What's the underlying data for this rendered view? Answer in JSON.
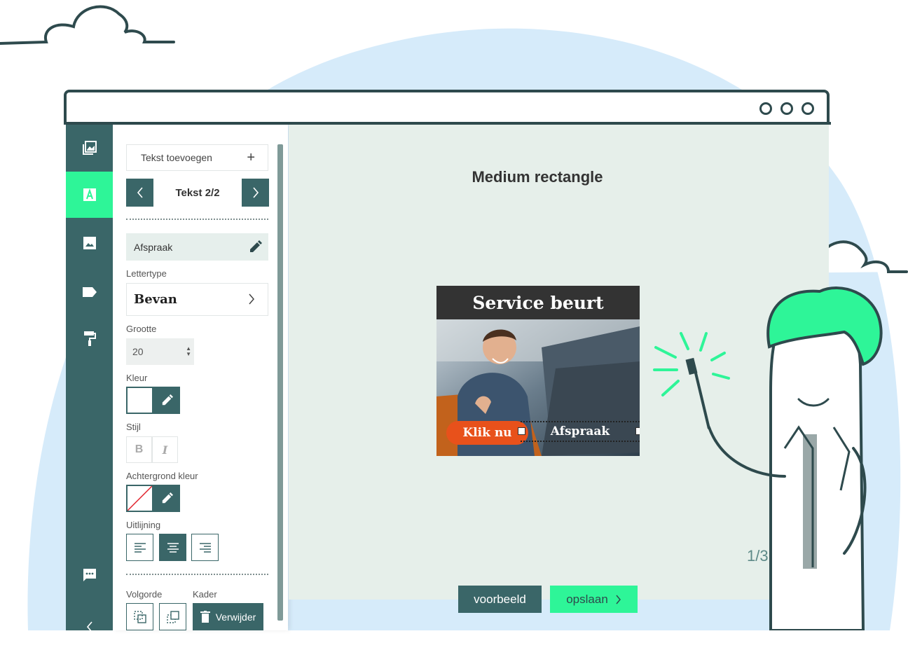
{
  "panel": {
    "add_text_label": "Tekst toevoegen",
    "nav_title": "Tekst 2/2",
    "layer_name": "Afspraak",
    "font_label": "Lettertype",
    "font_value": "Bevan",
    "size_label": "Grootte",
    "size_value": "20",
    "color_label": "Kleur",
    "style_label": "Stijl",
    "bold_label": "B",
    "italic_label": "I",
    "bg_color_label": "Achtergrond kleur",
    "align_label": "Uitlijning",
    "order_label": "Volgorde",
    "frame_label": "Kader",
    "delete_label": "Verwijder"
  },
  "canvas": {
    "title": "Medium rectangle",
    "page_counter": "1/3"
  },
  "ad": {
    "headline": "Service beurt",
    "cta": "Klik nu",
    "selected_text": "Afspraak"
  },
  "actions": {
    "preview_label": "voorbeeld",
    "save_label": "opslaan"
  },
  "colors": {
    "accent": "#2ef598",
    "primary": "#3a6668",
    "outline": "#2e4a4d",
    "sky": "#d6ebfa",
    "canvas_bg": "#e6efea",
    "cta": "#e8511b"
  },
  "icons": {
    "iconbar": [
      "gallery-icon",
      "text-icon",
      "image-icon",
      "label-icon",
      "paint-roller-icon",
      "chat-icon",
      "collapse-icon"
    ]
  }
}
